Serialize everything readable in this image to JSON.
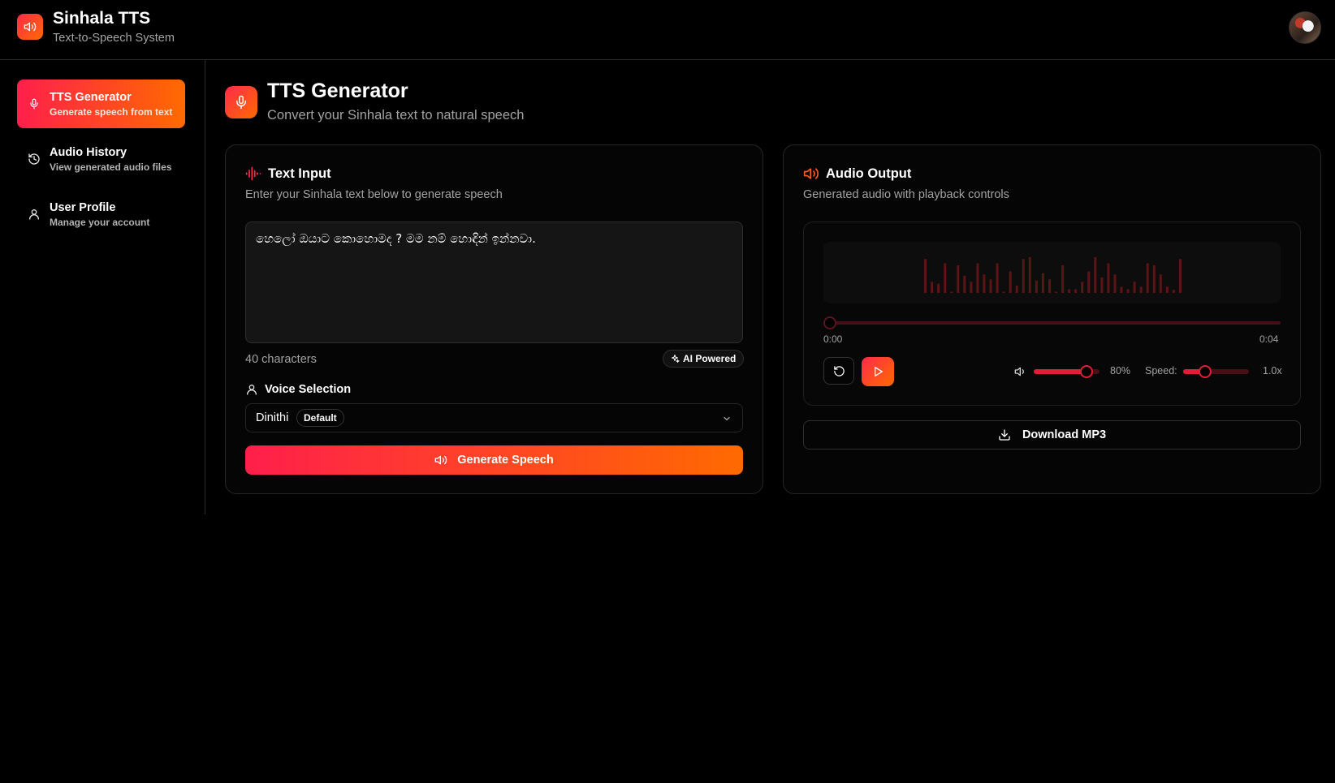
{
  "app": {
    "title": "Sinhala TTS",
    "subtitle": "Text-to-Speech System",
    "icon": "speaker-icon",
    "avatar": "user-avatar"
  },
  "colors": {
    "accent_start": "#ff1f4b",
    "accent_end": "#ff6a00",
    "background": "#000000",
    "muted_text": "#a3a3a3"
  },
  "sidebar": {
    "items": [
      {
        "title": "TTS Generator",
        "subtitle": "Generate speech from text",
        "icon": "mic-icon",
        "active": true
      },
      {
        "title": "Audio History",
        "subtitle": "View generated audio files",
        "icon": "history-icon",
        "active": false
      },
      {
        "title": "User Profile",
        "subtitle": "Manage your account",
        "icon": "user-icon",
        "active": false
      }
    ]
  },
  "page": {
    "title": "TTS Generator",
    "subtitle": "Convert your Sinhala text to natural speech",
    "icon": "mic-icon"
  },
  "text_input": {
    "title": "Text Input",
    "description": "Enter your Sinhala text below to generate speech",
    "value": "හෙලෝ ඔයාට කොහොමද ? මම නම් හොඳින් ඉන්නවා.",
    "char_count": "40 characters",
    "badge": "AI Powered",
    "voice_label": "Voice Selection",
    "voice_selected": "Dinithi",
    "voice_badge": "Default",
    "generate_label": "Generate Speech"
  },
  "audio_output": {
    "title": "Audio Output",
    "description": "Generated audio with playback controls",
    "time_start": "0:00",
    "time_end": "0:04",
    "progress": 0,
    "volume_percent": 80,
    "volume_text": "80%",
    "speed_label": "Speed:",
    "speed_value": 1.0,
    "speed_range": [
      0.5,
      2.0
    ],
    "speed_text": "1.0x",
    "waveform_levels": [
      0.55,
      0.18,
      0.15,
      0.48,
      0.02,
      0.45,
      0.28,
      0.18,
      0.48,
      0.3,
      0.22,
      0.48,
      0.02,
      0.35,
      0.12,
      0.55,
      0.58,
      0.2,
      0.32,
      0.22,
      0.02,
      0.45,
      0.06,
      0.06,
      0.18,
      0.35,
      0.58,
      0.25,
      0.48,
      0.3,
      0.1,
      0.06,
      0.18,
      0.1,
      0.48,
      0.45,
      0.3,
      0.1,
      0.05,
      0.55
    ],
    "download_label": "Download MP3"
  }
}
